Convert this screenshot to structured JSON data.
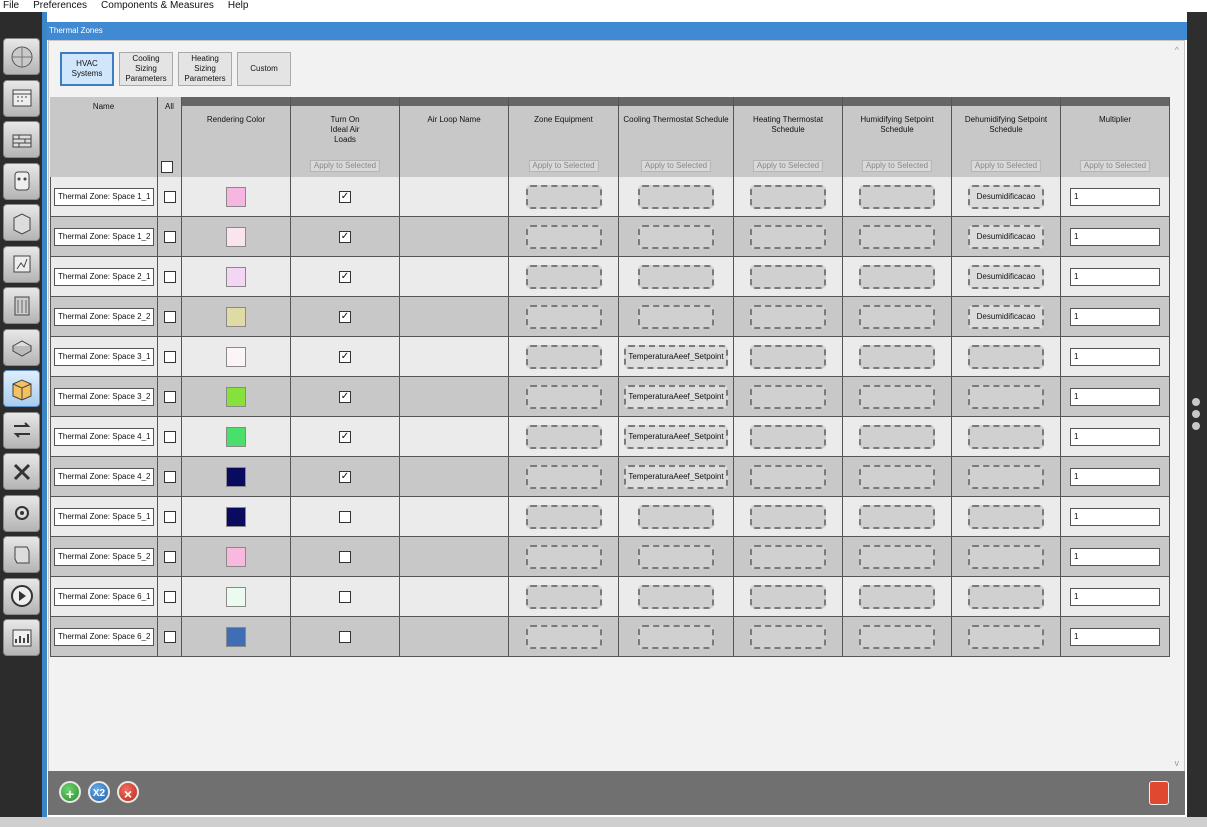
{
  "menu": [
    "File",
    "Preferences",
    "Components & Measures",
    "Help"
  ],
  "window": {
    "title": "Thermal Zones"
  },
  "tabs": [
    {
      "label": "HVAC Systems",
      "active": true
    },
    {
      "label": "Cooling Sizing Parameters",
      "active": false
    },
    {
      "label": "Heating Sizing Parameters",
      "active": false
    },
    {
      "label": "Custom",
      "active": false
    }
  ],
  "columns": {
    "name": "Name",
    "all": "All",
    "rendering_color": "Rendering Color",
    "ideal_air_loads": "Turn On Ideal Air Loads",
    "air_loop_name": "Air Loop Name",
    "zone_equipment": "Zone Equipment",
    "cooling_thermostat": "Cooling Thermostat Schedule",
    "heating_thermostat": "Heating Thermostat Schedule",
    "humidifying_setpoint": "Humidifying Setpoint Schedule",
    "dehumidifying_setpoint": "Dehumidifying Setpoint Schedule",
    "multiplier": "Multiplier",
    "apply_to_selected": "Apply to Selected"
  },
  "rows": [
    {
      "name": "Thermal Zone: Space 1_1",
      "color": "#f7b6e2",
      "ideal": true,
      "cooling": "",
      "dehum": "Desumidificacao",
      "multiplier": "1"
    },
    {
      "name": "Thermal Zone: Space 1_2",
      "color": "#fae4ee",
      "ideal": true,
      "cooling": "",
      "dehum": "Desumidificacao",
      "multiplier": "1"
    },
    {
      "name": "Thermal Zone: Space 2_1",
      "color": "#f3d6f4",
      "ideal": true,
      "cooling": "",
      "dehum": "Desumidificacao",
      "multiplier": "1"
    },
    {
      "name": "Thermal Zone: Space 2_2",
      "color": "#dedba6",
      "ideal": true,
      "cooling": "",
      "dehum": "Desumidificacao",
      "multiplier": "1"
    },
    {
      "name": "Thermal Zone: Space 3_1",
      "color": "#fdf4f7",
      "ideal": true,
      "cooling": "TemperaturaAeef_Setpoint",
      "dehum": "",
      "multiplier": "1"
    },
    {
      "name": "Thermal Zone: Space 3_2",
      "color": "#88e03c",
      "ideal": true,
      "cooling": "TemperaturaAeef_Setpoint",
      "dehum": "",
      "multiplier": "1"
    },
    {
      "name": "Thermal Zone: Space 4_1",
      "color": "#4ade6a",
      "ideal": true,
      "cooling": "TemperaturaAeef_Setpoint",
      "dehum": "",
      "multiplier": "1"
    },
    {
      "name": "Thermal Zone: Space 4_2",
      "color": "#0a0a5e",
      "ideal": true,
      "cooling": "TemperaturaAeef_Setpoint",
      "dehum": "",
      "multiplier": "1"
    },
    {
      "name": "Thermal Zone: Space 5_1",
      "color": "#0a0a5e",
      "ideal": false,
      "cooling": "",
      "dehum": "",
      "multiplier": "1"
    },
    {
      "name": "Thermal Zone: Space 5_2",
      "color": "#f9b8de",
      "ideal": false,
      "cooling": "",
      "dehum": "",
      "multiplier": "1"
    },
    {
      "name": "Thermal Zone: Space 6_1",
      "color": "#ecfbf0",
      "ideal": false,
      "cooling": "",
      "dehum": "",
      "multiplier": "1"
    },
    {
      "name": "Thermal Zone: Space 6_2",
      "color": "#3f6eb5",
      "ideal": false,
      "cooling": "",
      "dehum": "",
      "multiplier": "1"
    }
  ],
  "footer": {
    "duplicate_label": "X2"
  },
  "left_toolbar": [
    {
      "icon": "site-icon",
      "active": false
    },
    {
      "icon": "schedules-icon",
      "active": false
    },
    {
      "icon": "constructions-icon",
      "active": false
    },
    {
      "icon": "loads-icon",
      "active": false
    },
    {
      "icon": "space-types-icon",
      "active": false
    },
    {
      "icon": "geometry-icon",
      "active": false
    },
    {
      "icon": "facility-icon",
      "active": false
    },
    {
      "icon": "spaces-icon",
      "active": false
    },
    {
      "icon": "thermal-zones-icon",
      "active": true
    },
    {
      "icon": "hvac-systems-icon",
      "active": false
    },
    {
      "icon": "measures-icon",
      "active": false
    },
    {
      "icon": "simulation-settings-icon",
      "active": false
    },
    {
      "icon": "scripts-icon",
      "active": false
    },
    {
      "icon": "run-icon",
      "active": false
    },
    {
      "icon": "results-icon",
      "active": false
    }
  ]
}
